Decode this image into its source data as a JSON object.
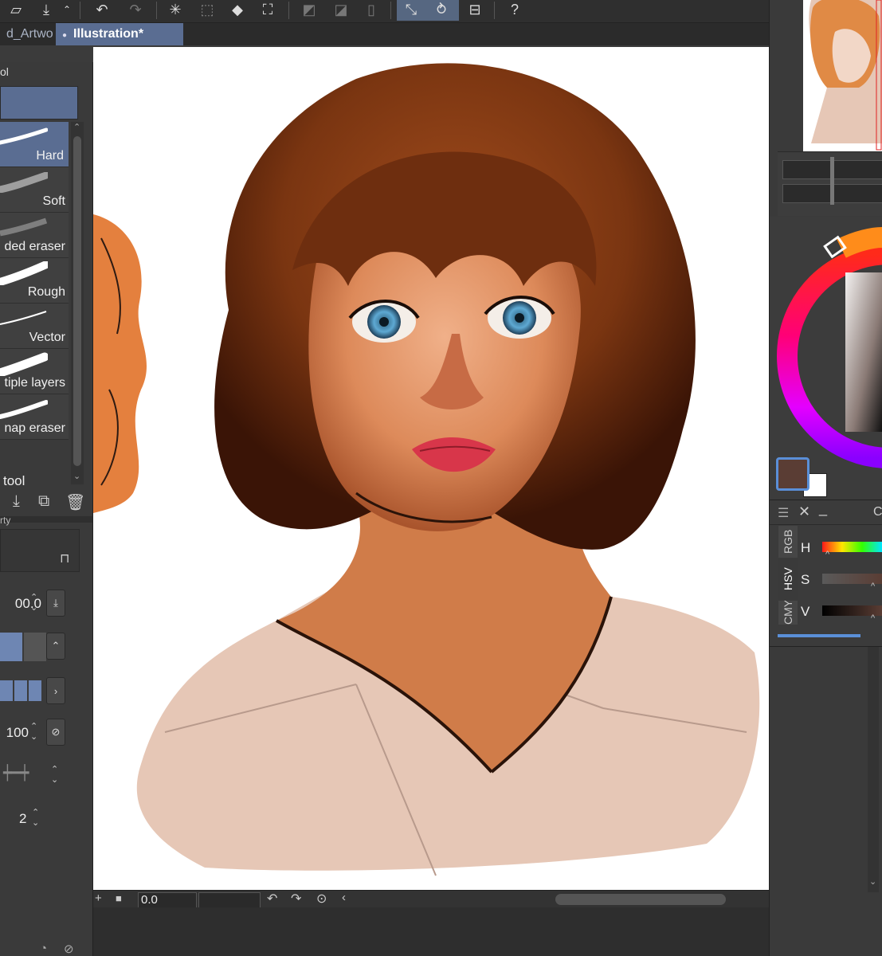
{
  "tabs": {
    "left_tab": "d_Artwo",
    "active_tab": "Illustration*"
  },
  "tool_panel": {
    "title": "ol",
    "brushes": [
      {
        "label": "Hard",
        "selected": true
      },
      {
        "label": "Soft",
        "selected": false
      },
      {
        "label": "ded eraser",
        "selected": false
      },
      {
        "label": "Rough",
        "selected": false
      },
      {
        "label": "Vector",
        "selected": false
      },
      {
        "label": "tiple layers",
        "selected": false
      },
      {
        "label": "nap eraser",
        "selected": false
      }
    ],
    "footer_label": "tool"
  },
  "property_panel": {
    "title": "rty",
    "size_value": "00.0",
    "opacity_value": "100",
    "last_value": "2"
  },
  "status_bar": {
    "rotation_value": "0.0"
  },
  "color_panel": {
    "current_color": "#5a3d34",
    "secondary_color": "#ffffff"
  },
  "slider_panel": {
    "header_letter": "C",
    "tabs": [
      "RGB",
      "HSV",
      "CMY"
    ],
    "active_tab": "HSV",
    "rows": [
      {
        "label": "H"
      },
      {
        "label": "S"
      },
      {
        "label": "V"
      }
    ]
  },
  "colors": {
    "accent": "#5a6d92",
    "panel": "#3a3a3a",
    "toolbar": "#2f2f2f"
  }
}
